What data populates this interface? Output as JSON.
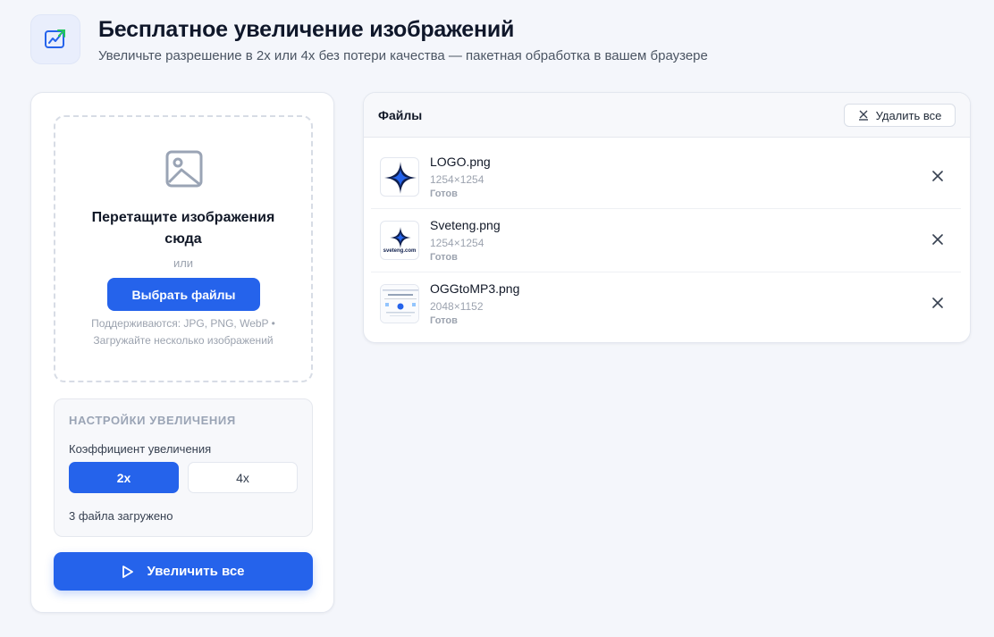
{
  "header": {
    "title": "Бесплатное увеличение изображений",
    "subtitle": "Увеличьте разрешение в 2x или 4x без потери качества — пакетная обработка в вашем браузере",
    "logo_icon": "chart-trend-icon"
  },
  "upload": {
    "icon": "image-icon",
    "title": "Перетащите изображения сюда",
    "or": "или",
    "choose_button": "Выбрать файлы",
    "support_line1": "Поддерживаются: JPG, PNG, WebP •",
    "support_line2": "Загружайте несколько изображений"
  },
  "settings": {
    "title": "НАСТРОЙКИ УВЕЛИЧЕНИЯ",
    "factor_label": "Коэффициент увеличения",
    "options": [
      "2x",
      "4x"
    ],
    "selected": "2x",
    "files_count": "3 файла загружено"
  },
  "actions": {
    "upscale_all": "Увеличить все",
    "upscale_icon": "play-icon"
  },
  "files": {
    "title": "Файлы",
    "delete_all": "Удалить все",
    "delete_icon": "clear-icon",
    "items": [
      {
        "name": "LOGO.png",
        "dims": "1254×1254",
        "status": "Готов",
        "thumb": "star-logo"
      },
      {
        "name": "Sveteng.png",
        "dims": "1254×1254",
        "status": "Готов",
        "thumb": "star-logo-text",
        "thumb_caption": "sveteng.com"
      },
      {
        "name": "OGGtoMP3.png",
        "dims": "2048×1152",
        "status": "Готов",
        "thumb": "webpage-preview"
      }
    ]
  },
  "colors": {
    "accent": "#2563eb",
    "background": "#f4f6fb",
    "star_dark": "#0f1f4d",
    "logo_green": "#22c55e"
  }
}
